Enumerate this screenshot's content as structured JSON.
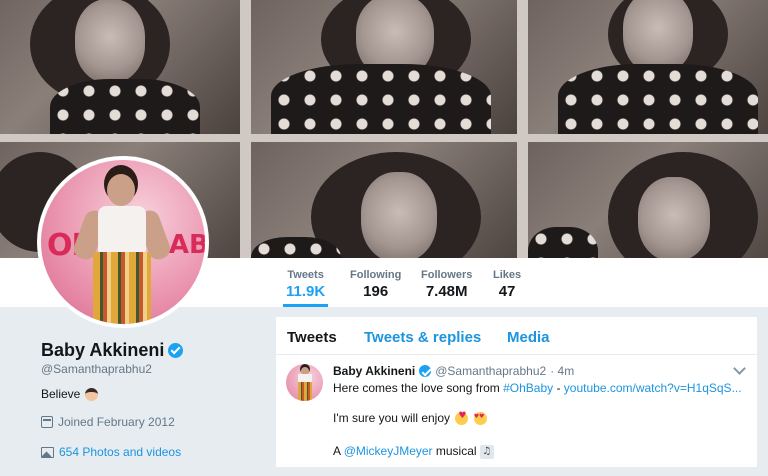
{
  "profile": {
    "name": "Baby Akkineni",
    "handle": "@Samanthaprabhu2",
    "bio": "Believe",
    "joined": "Joined February 2012",
    "photos": "654 Photos and videos",
    "avatar_text_left": "OH!",
    "avatar_text_right": "BABY"
  },
  "stats": [
    {
      "label": "Tweets",
      "value": "11.9K"
    },
    {
      "label": "Following",
      "value": "196"
    },
    {
      "label": "Followers",
      "value": "7.48M"
    },
    {
      "label": "Likes",
      "value": "47"
    }
  ],
  "tabs": [
    "Tweets",
    "Tweets & replies",
    "Media"
  ],
  "tweet": {
    "name": "Baby Akkineni",
    "handle": "@Samanthaprabhu2",
    "time": "· 4m",
    "line1_text": "Here comes the love song from ",
    "line1_hashtag": "#OhBaby",
    "line1_sep": " - ",
    "line1_link": "youtube.com/watch?v=H1qSqS...",
    "line2_text": "I'm sure you will enjoy",
    "line3_prefix": "A ",
    "line3_mention": "@MickeyJMeyer",
    "line3_suffix": " musical"
  },
  "icons": {
    "verified": "verified-badge-icon",
    "calendar": "calendar-icon",
    "photos": "image-icon",
    "chevron": "chevron-down-icon"
  },
  "colors": {
    "accent": "#1da1f2",
    "link": "#1b95e0",
    "muted": "#657786",
    "background": "#e6ecf0"
  }
}
